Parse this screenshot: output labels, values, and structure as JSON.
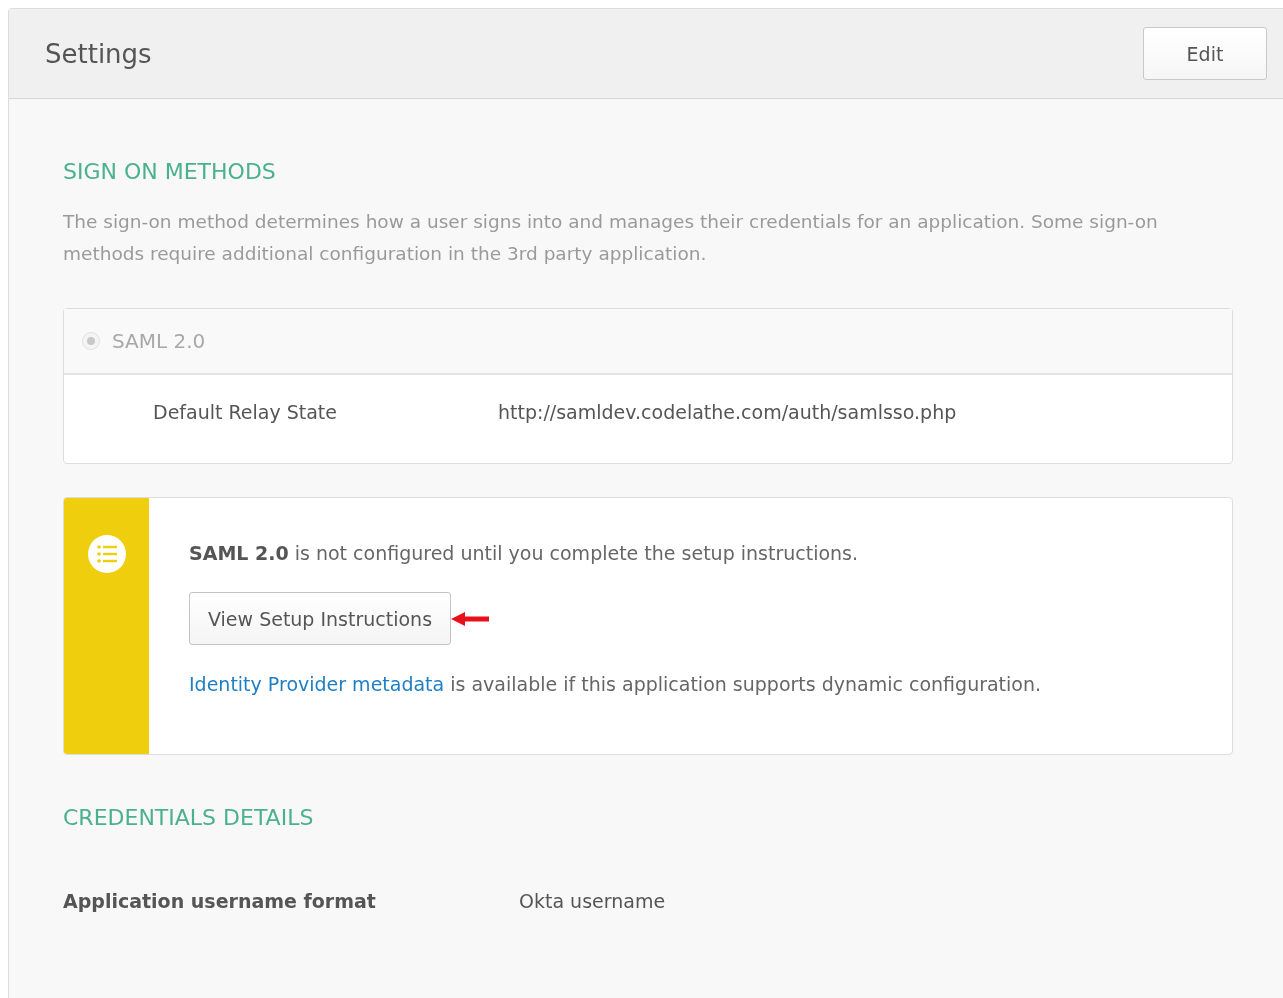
{
  "panel": {
    "title": "Settings",
    "edit_button": "Edit"
  },
  "sign_on": {
    "heading": "SIGN ON METHODS",
    "description": "The sign-on method determines how a user signs into and manages their credentials for an application. Some sign-on methods require additional configuration in the 3rd party application.",
    "methods": [
      {
        "label": "SAML 2.0",
        "selected": true,
        "disabled": true
      }
    ],
    "fields": [
      {
        "label": "Default Relay State",
        "value": "http://samldev.codelathe.com/auth/samlsso.php"
      }
    ]
  },
  "notice": {
    "message": "**SAML 2.0** is not configured until you complete the setup instructions.",
    "button": "View Setup Instructions",
    "link": "Identity Provider metadata",
    "link_rest": " is available if this application supports dynamic configuration."
  },
  "credentials": {
    "heading": "CREDENTIALS DETAILS",
    "fields": [
      {
        "label": "Application username format",
        "value": "Okta username"
      }
    ]
  }
}
